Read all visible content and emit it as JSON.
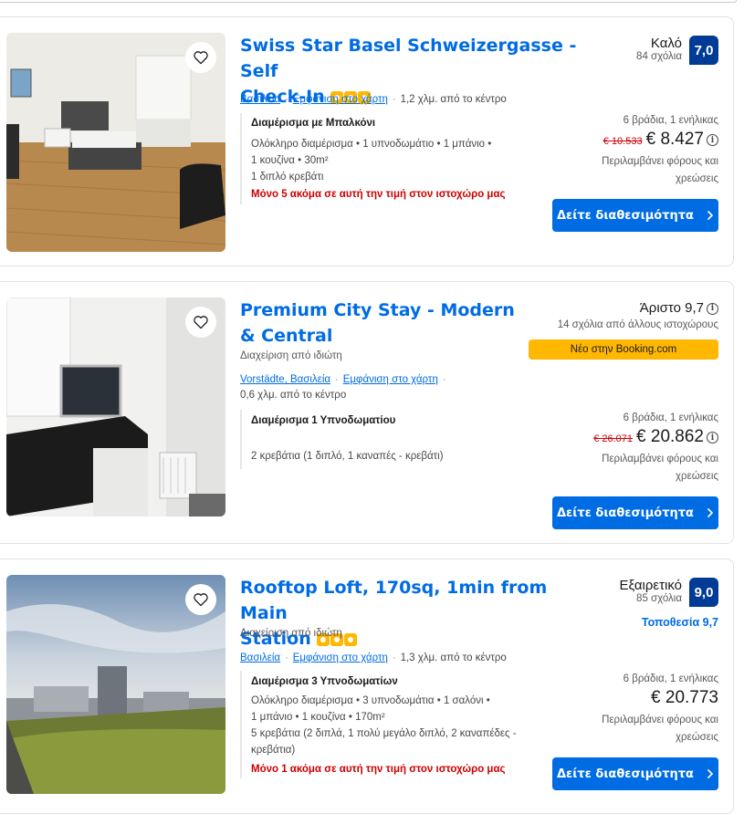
{
  "colors": {
    "brand_blue": "#006ce4",
    "score_blue": "#003b95",
    "urgent_red": "#cc0000",
    "badge_yellow": "#ffb700"
  },
  "properties": [
    {
      "title": "Swiss Star Basel Schweizergasse - Self Check-In",
      "title_line1": "Swiss Star Basel Schweizergasse - Self",
      "title_line2": "Check-In",
      "location_link": "Βασιλεία",
      "map_link": "Εμφάνιση στο χάρτη",
      "distance": "1,2 χλμ. από το κέντρο",
      "room_type": "Διαμέρισμα με Μπαλκόνι",
      "details_line1": "Ολόκληρο διαμέρισμα • 1 υπνοδωμάτιο • 1 μπάνιο •",
      "details_line2": "1 κουζίνα • 30m²",
      "beds": "1 διπλό κρεβάτι",
      "urgency": "Μόνο 5 ακόμα σε αυτή την τιμή στον ιστοχώρο μας",
      "review_word": "Καλό",
      "review_count": "84 σχόλια",
      "score": "7,0",
      "nights": "6 βράδια, 1 ενήλικας",
      "old_price": "€ 10.533",
      "price": "€ 8.427",
      "taxes_line1": "Περιλαμβάνει φόρους και",
      "taxes_line2": "χρεώσεις",
      "cta": "Δείτε διαθεσιμότητα",
      "icons": [
        "heart-icon",
        "star-icon",
        "info-icon",
        "chevron-right-icon"
      ]
    },
    {
      "title_line1": "Premium City Stay - Modern",
      "title_line2": "& Central",
      "managed_by": "Διαχείριση από ιδιώτη",
      "location_link": "Vorstädte, Βασιλεία",
      "map_link": "Εμφάνιση στο χάρτη",
      "distance": "0,6 χλμ. από το κέντρο",
      "room_type": "Διαμέρισμα 1 Υπνοδωματίου",
      "beds": "2 κρεβάτια (1 διπλό, 1 καναπές - κρεβάτι)",
      "review_word": "Άριστο 9,7",
      "review_count": "14 σχόλια από άλλους ιστοχώρους",
      "new_badge": "Νέο στην Booking.com",
      "nights": "6 βράδια, 1 ενήλικας",
      "old_price": "€ 26.071",
      "price": "€ 20.862",
      "taxes_line1": "Περιλαμβάνει φόρους και",
      "taxes_line2": "χρεώσεις",
      "cta": "Δείτε διαθεσιμότητα"
    },
    {
      "title_line1": "Rooftop Loft, 170sq, 1min from Main",
      "title_line2": "Station",
      "managed_by": "Διαχείριση από ιδιώτη",
      "location_link": "Βασιλεία",
      "map_link": "Εμφάνιση στο χάρτη",
      "distance": "1,3 χλμ. από το κέντρο",
      "room_type": "Διαμέρισμα 3 Υπνοδωματίων",
      "details_line1": "Ολόκληρο διαμέρισμα • 3 υπνοδωμάτια • 1 σαλόνι •",
      "details_line2": "1 μπάνιο • 1 κουζίνα • 170m²",
      "beds_line1": "5 κρεβάτια (2 διπλά, 1 πολύ μεγάλο διπλό, 2 καναπέδες -",
      "beds_line2": "κρεβάτια)",
      "urgency": "Μόνο 1 ακόμα σε αυτή την τιμή στον ιστοχώρο μας",
      "review_word": "Εξαιρετικό",
      "review_count": "85 σχόλια",
      "score": "9,0",
      "location_score": "Τοποθεσία 9,7",
      "nights": "6 βράδια, 1 ενήλικας",
      "price": "€ 20.773",
      "taxes_line1": "Περιλαμβάνει φόρους και",
      "taxes_line2": "χρεώσεις",
      "cta": "Δείτε διαθεσιμότητα"
    }
  ]
}
